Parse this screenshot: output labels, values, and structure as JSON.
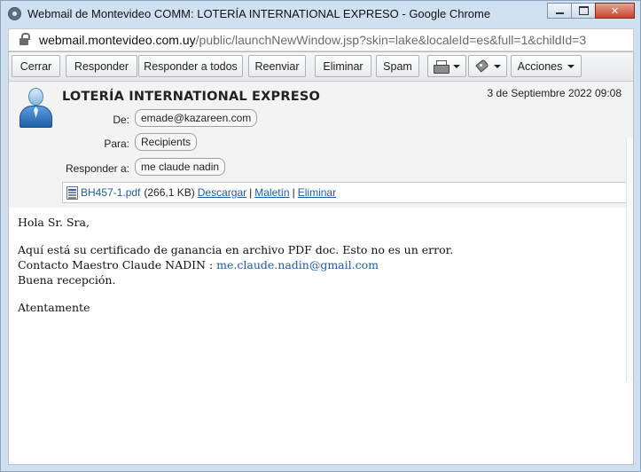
{
  "window": {
    "title": "Webmail de Montevideo COMM: LOTERÍA INTERNATIONAL EXPRESO - Google Chrome",
    "url_host": "webmail.montevideo.com.uy",
    "url_path": "/public/launchNewWindow.jsp?skin=lake&localeId=es&full=1&childId=3"
  },
  "toolbar": {
    "cerrar": "Cerrar",
    "responder": "Responder",
    "responder_todos": "Responder a todos",
    "reenviar": "Reenviar",
    "eliminar": "Eliminar",
    "spam": "Spam",
    "acciones": "Acciones"
  },
  "message": {
    "subject": "LOTERÍA INTERNATIONAL EXPRESO",
    "date": "3 de Septiembre 2022 09:08",
    "from_label": "De:",
    "from_value": "emade@kazareen.com",
    "to_label": "Para:",
    "to_value": "Recipients",
    "reply_label": "Responder a:",
    "reply_value": "me claude nadin",
    "attachment": {
      "filename": "BH457-1.pdf",
      "size": "(266,1 KB)",
      "download": "Descargar",
      "briefcase": "Maletín",
      "remove": "Eliminar",
      "separator": "|"
    },
    "body": {
      "greeting": "Hola Sr. Sra,",
      "line1": "Aquí está su certificado de ganancia en archivo PDF doc. Esto no es un error.",
      "line2_prefix": "Contacto Maestro Claude NADIN : ",
      "line2_email": "me.claude.nadin@gmail.com",
      "line3": "Buena recepción.",
      "closing": "Atentamente"
    }
  }
}
